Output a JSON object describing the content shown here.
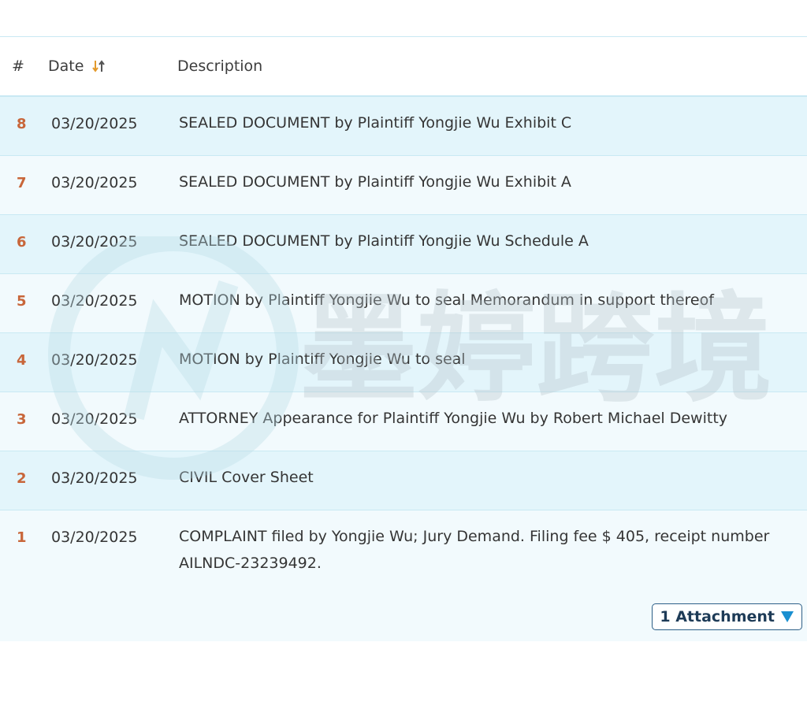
{
  "table": {
    "headers": {
      "num": "#",
      "date": "Date",
      "description": "Description"
    },
    "rows": [
      {
        "num": "8",
        "date": "03/20/2025",
        "description": "SEALED DOCUMENT by Plaintiff Yongjie Wu Exhibit C"
      },
      {
        "num": "7",
        "date": "03/20/2025",
        "description": "SEALED DOCUMENT by Plaintiff Yongjie Wu Exhibit A"
      },
      {
        "num": "6",
        "date": "03/20/2025",
        "description": "SEALED DOCUMENT by Plaintiff Yongjie Wu Schedule A"
      },
      {
        "num": "5",
        "date": "03/20/2025",
        "description": "MOTION by Plaintiff Yongjie Wu to seal Memorandum in support thereof"
      },
      {
        "num": "4",
        "date": "03/20/2025",
        "description": "MOTION by Plaintiff Yongjie Wu to seal"
      },
      {
        "num": "3",
        "date": "03/20/2025",
        "description": "ATTORNEY Appearance for Plaintiff Yongjie Wu by Robert Michael Dewitty"
      },
      {
        "num": "2",
        "date": "03/20/2025",
        "description": "CIVIL Cover Sheet"
      },
      {
        "num": "1",
        "date": "03/20/2025",
        "description": "COMPLAINT filed by Yongjie Wu; Jury Demand. Filing fee $ 405, receipt number AILNDC-23239492.",
        "attachment_label": "1 Attachment"
      }
    ]
  },
  "watermark": {
    "text": "墨婷跨境"
  },
  "icons": {
    "sort": "sort-arrows-icon",
    "dropdown": "dropdown-triangle-icon"
  },
  "colors": {
    "row_alt": "#e3f5fb",
    "row_plain": "#f2fafd",
    "num": "#c8663a",
    "sort_icon": "#e39a2b",
    "attach_arrow": "#1a8fd0"
  }
}
